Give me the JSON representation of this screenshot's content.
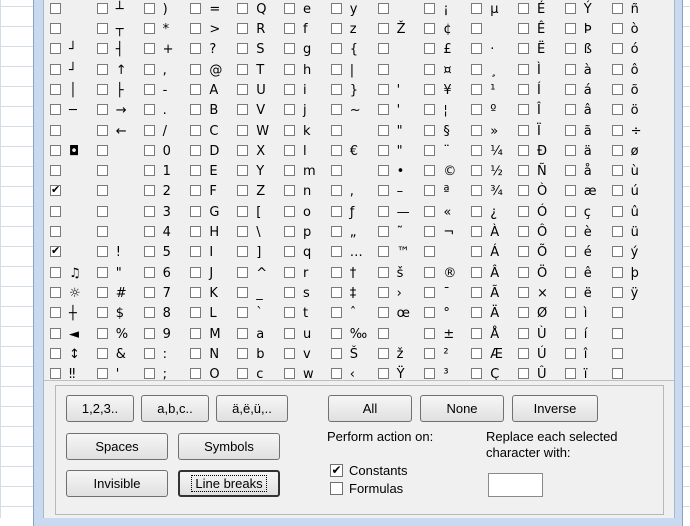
{
  "columns": [
    {
      "chars": [
        "",
        "",
        "",
        "",
        "",
        "",
        "",
        "",
        "",
        "",
        "",
        "",
        "",
        "",
        "",
        "",
        "",
        ""
      ],
      "checked": [
        false,
        false,
        false,
        false,
        false,
        false,
        false,
        false,
        true,
        false,
        false,
        true,
        false,
        false,
        false,
        false,
        false,
        false
      ]
    },
    {
      "chars": [
        "┬",
        "┤",
        "↑",
        "├",
        "→",
        "←",
        "",
        "",
        "",
        "",
        "",
        "!",
        "\"",
        "#",
        "$",
        "%",
        "&",
        "'"
      ],
      "checked": [
        false,
        false,
        false,
        false,
        false,
        false,
        false,
        false,
        false,
        false,
        false,
        false,
        false,
        false,
        false,
        false,
        false,
        false
      ]
    },
    {
      "chars": [
        "*",
        "+",
        ",",
        "-",
        ".",
        "/",
        "0",
        "1",
        "2",
        "3",
        "4",
        "5",
        "6",
        "7",
        "8",
        "9",
        ":",
        ";"
      ],
      "checked": [
        false,
        false,
        false,
        false,
        false,
        false,
        false,
        false,
        false,
        false,
        false,
        false,
        false,
        false,
        false,
        false,
        false,
        false
      ]
    },
    {
      "chars": [
        ">",
        "?",
        "@",
        "A",
        "B",
        "C",
        "D",
        "E",
        "F",
        "G",
        "H",
        "I",
        "J",
        "K",
        "L",
        "M",
        "N",
        "O"
      ],
      "checked": [
        false,
        false,
        false,
        false,
        false,
        false,
        false,
        false,
        false,
        false,
        false,
        false,
        false,
        false,
        false,
        false,
        false,
        false
      ]
    },
    {
      "chars": [
        "R",
        "S",
        "T",
        "U",
        "V",
        "W",
        "X",
        "Y",
        "Z",
        "[",
        "\\",
        "]",
        "^",
        "_",
        "`",
        "a",
        "b",
        "c"
      ],
      "checked": [
        false,
        false,
        false,
        false,
        false,
        false,
        false,
        false,
        false,
        false,
        false,
        false,
        false,
        false,
        false,
        false,
        false,
        false
      ]
    },
    {
      "chars": [
        "f",
        "g",
        "h",
        "i",
        "j",
        "k",
        "l",
        "m",
        "n",
        "o",
        "p",
        "q",
        "r",
        "s",
        "t",
        "u",
        "v",
        "w"
      ],
      "checked": [
        false,
        false,
        false,
        false,
        false,
        false,
        false,
        false,
        false,
        false,
        false,
        false,
        false,
        false,
        false,
        false,
        false,
        false
      ]
    },
    {
      "chars": [
        "z",
        "{",
        "|",
        "}",
        "~",
        "",
        "€",
        "",
        ",",
        "ƒ",
        "„",
        "…",
        "†",
        "‡",
        "ˆ",
        "‰",
        "Š",
        "‹"
      ],
      "checked": [
        false,
        false,
        false,
        false,
        false,
        false,
        false,
        false,
        false,
        false,
        false,
        false,
        false,
        false,
        false,
        false,
        false,
        false
      ]
    },
    {
      "chars": [
        "Ž",
        "",
        "",
        "'",
        "'",
        "\"",
        "\"",
        "•",
        "–",
        "—",
        "˜",
        "™",
        "š",
        "›",
        "œ",
        "",
        "ž",
        "Ÿ"
      ],
      "checked": [
        false,
        false,
        false,
        false,
        false,
        false,
        false,
        false,
        false,
        false,
        false,
        false,
        false,
        false,
        false,
        false,
        false,
        false
      ]
    },
    {
      "chars": [
        "¢",
        "£",
        "¤",
        "¥",
        "¦",
        "§",
        "¨",
        "©",
        "ª",
        "«",
        "¬",
        "",
        "®",
        "¯",
        "°",
        "±",
        "²",
        "³"
      ],
      "checked": [
        false,
        false,
        false,
        false,
        false,
        false,
        false,
        false,
        false,
        false,
        false,
        false,
        false,
        false,
        false,
        false,
        false,
        false
      ]
    },
    {
      "chars": [
        "",
        "·",
        "¸",
        "¹",
        "º",
        "»",
        "¼",
        "½",
        "¾",
        "¿",
        "À",
        "Á",
        "Â",
        "Ã",
        "Ä",
        "Å",
        "Æ",
        "Ç"
      ],
      "checked": [
        false,
        false,
        false,
        false,
        false,
        false,
        false,
        false,
        false,
        false,
        false,
        false,
        false,
        false,
        false,
        false,
        false,
        false
      ]
    },
    {
      "chars": [
        "Ê",
        "Ë",
        "Ì",
        "Í",
        "Î",
        "Ï",
        "Ð",
        "Ñ",
        "Ò",
        "Ó",
        "Ô",
        "Õ",
        "Ö",
        "×",
        "Ø",
        "Ù",
        "Ú",
        "Û"
      ],
      "checked": [
        false,
        false,
        false,
        false,
        false,
        false,
        false,
        false,
        false,
        false,
        false,
        false,
        false,
        false,
        false,
        false,
        false,
        false
      ]
    },
    {
      "chars": [
        "Þ",
        "ß",
        "à",
        "á",
        "â",
        "ã",
        "ä",
        "å",
        "æ",
        "ç",
        "è",
        "é",
        "ê",
        "ë",
        "ì",
        "í",
        "î",
        "ï"
      ],
      "checked": [
        false,
        false,
        false,
        false,
        false,
        false,
        false,
        false,
        false,
        false,
        false,
        false,
        false,
        false,
        false,
        false,
        false,
        false
      ]
    },
    {
      "chars": [
        "ò",
        "ó",
        "ô",
        "õ",
        "ö",
        "÷",
        "ø",
        "ù",
        "ú",
        "û",
        "ü",
        "ý",
        "þ",
        "ÿ",
        "",
        "",
        "",
        ""
      ],
      "checked": [
        false,
        false,
        false,
        false,
        false,
        false,
        false,
        false,
        false,
        false,
        false,
        false,
        false,
        false,
        false,
        false,
        false,
        false
      ]
    }
  ],
  "col0_glyphs": [
    "",
    "┘",
    "┘",
    "│",
    "─",
    "",
    "◘",
    "",
    "",
    "",
    "",
    "",
    "♫",
    "☼",
    "┼",
    "◄",
    "↕",
    "‼"
  ],
  "top_row": [
    {
      "ch": "",
      "col": 0
    },
    {
      "ch": "┴",
      "col": 1
    },
    {
      "ch": ")",
      "col": 2
    },
    {
      "ch": "=",
      "col": 3
    },
    {
      "ch": "Q",
      "col": 4
    },
    {
      "ch": "e",
      "col": 5
    },
    {
      "ch": "y",
      "col": 6
    },
    {
      "ch": "",
      "col": 7
    },
    {
      "ch": "¡",
      "col": 8
    },
    {
      "ch": "µ",
      "col": 9
    },
    {
      "ch": "É",
      "col": 10
    },
    {
      "ch": "Ý",
      "col": 11
    },
    {
      "ch": "ñ",
      "col": 12
    }
  ],
  "buttons": {
    "digits": "1,2,3..",
    "lower": "a,b,c..",
    "accented": "ä,ë,ü,..",
    "spaces": "Spaces",
    "symbols": "Symbols",
    "invisible": "Invisible",
    "line_breaks": "Line breaks",
    "all": "All",
    "none": "None",
    "inverse": "Inverse"
  },
  "perform_label": "Perform action on:",
  "options": {
    "constants": {
      "label": "Constants",
      "checked": true
    },
    "formulas": {
      "label": "Formulas",
      "checked": false
    }
  },
  "replace_label": "Replace each selected character with:",
  "replace_value": ""
}
